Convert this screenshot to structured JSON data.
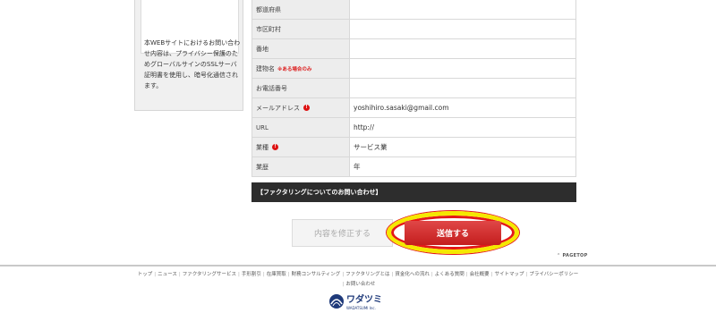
{
  "sidebar": {
    "notice": "本WEBサイトにおけるお問い合わせ内容は、プライバシー保護のためグローバルサインのSSLサーバ証明書を使用し、暗号化通信されます。"
  },
  "form": {
    "rows": [
      {
        "label": "都道府県",
        "value": "",
        "required": false,
        "note": ""
      },
      {
        "label": "市区町村",
        "value": "",
        "required": false,
        "note": ""
      },
      {
        "label": "番地",
        "value": "",
        "required": false,
        "note": ""
      },
      {
        "label": "建物名",
        "value": "",
        "required": false,
        "note": "※ある場合のみ"
      },
      {
        "label": "お電話番号",
        "value": "",
        "required": false,
        "note": ""
      },
      {
        "label": "メールアドレス",
        "value": "yoshihiro.sasaki@gmail.com",
        "required": true,
        "note": ""
      },
      {
        "label": "URL",
        "value": "http://",
        "required": false,
        "note": ""
      },
      {
        "label": "業種",
        "value": "サービス業",
        "required": true,
        "note": ""
      },
      {
        "label": "業歴",
        "value": "年",
        "required": false,
        "note": ""
      }
    ],
    "required_mark": "!"
  },
  "section_title": "【ファクタリングについてのお問い合わせ】",
  "buttons": {
    "modify": "内容を修正する",
    "submit": "送信する"
  },
  "pagetop": "PAGETOP",
  "footer": {
    "links": [
      "トップ",
      "ニュース",
      "ファクタリングサービス",
      "手形割引",
      "在庫買取",
      "財務コンサルティング",
      "ファクタリングとは",
      "資金化への流れ",
      "よくある質問",
      "会社概要",
      "サイトマップ",
      "プライバシーポリシー",
      "お問い合わせ"
    ]
  },
  "logo": {
    "text": "ワダツミ",
    "subtext": "WADATSUMI Inc."
  },
  "colors": {
    "submit": "#d13232",
    "highlight_outer": "#f5e800",
    "highlight_inner": "#e41818",
    "section_bar": "#2d2d2d"
  }
}
